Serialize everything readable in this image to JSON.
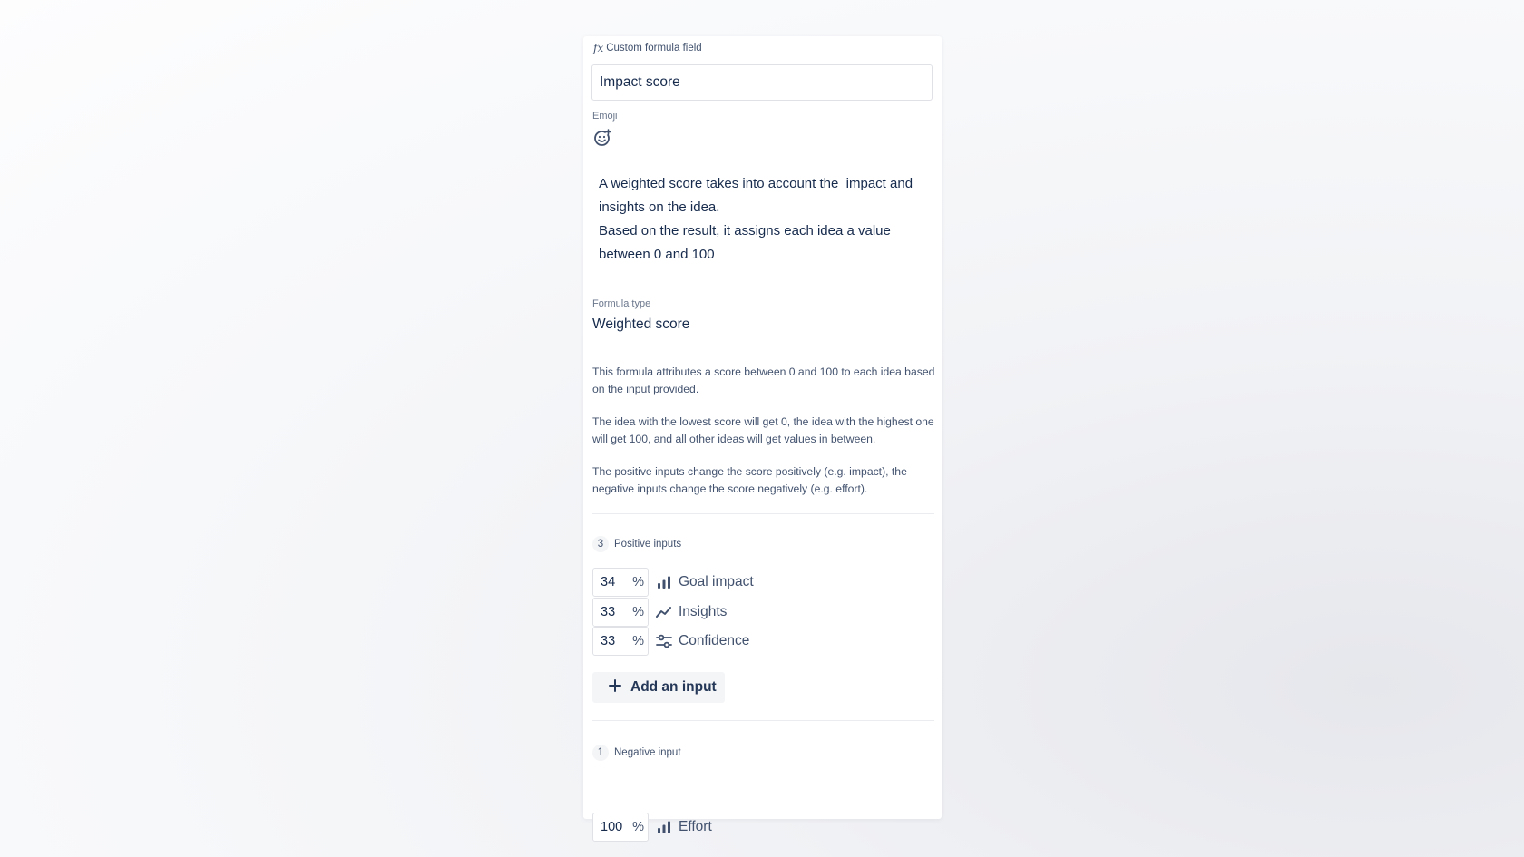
{
  "header": {
    "fx_symbol": "fx",
    "label": "Custom formula field"
  },
  "name_input": {
    "value": "Impact score"
  },
  "emoji": {
    "label": "Emoji",
    "icon": "add-emoji-icon"
  },
  "description": {
    "line1": "A weighted score takes into account the  impact and insights on the idea.",
    "line2": "Based on the result, it assigns each idea a value between 0 and 100"
  },
  "formula_type": {
    "label": "Formula type",
    "value": "Weighted score"
  },
  "help": {
    "p1": "This formula attributes a score between 0 and 100 to each idea based on the input provided.",
    "p2": "The idea with the lowest score will get 0, the idea with the highest one will get 100, and all other ideas will get values in between.",
    "p3": "The positive inputs change the score positively (e.g. impact), the negative inputs change the score negatively (e.g. effort)."
  },
  "positive": {
    "count": "3",
    "label": "Positive inputs",
    "inputs": [
      {
        "value": "34",
        "unit": "%",
        "icon": "bar-chart-icon",
        "label": "Goal impact"
      },
      {
        "value": "33",
        "unit": "%",
        "icon": "line-chart-icon",
        "label": "Insights"
      },
      {
        "value": "33",
        "unit": "%",
        "icon": "sliders-icon",
        "label": "Confidence"
      }
    ],
    "add_label": "Add an input"
  },
  "negative": {
    "count": "1",
    "label": "Negative input",
    "inputs": [
      {
        "value": "100",
        "unit": "%",
        "icon": "bar-chart-icon",
        "label": "Effort"
      }
    ]
  },
  "colors": {
    "text": "#172b4d",
    "muted": "#42526e",
    "border": "#dfe1e6",
    "button_bg": "#f4f5f7"
  }
}
